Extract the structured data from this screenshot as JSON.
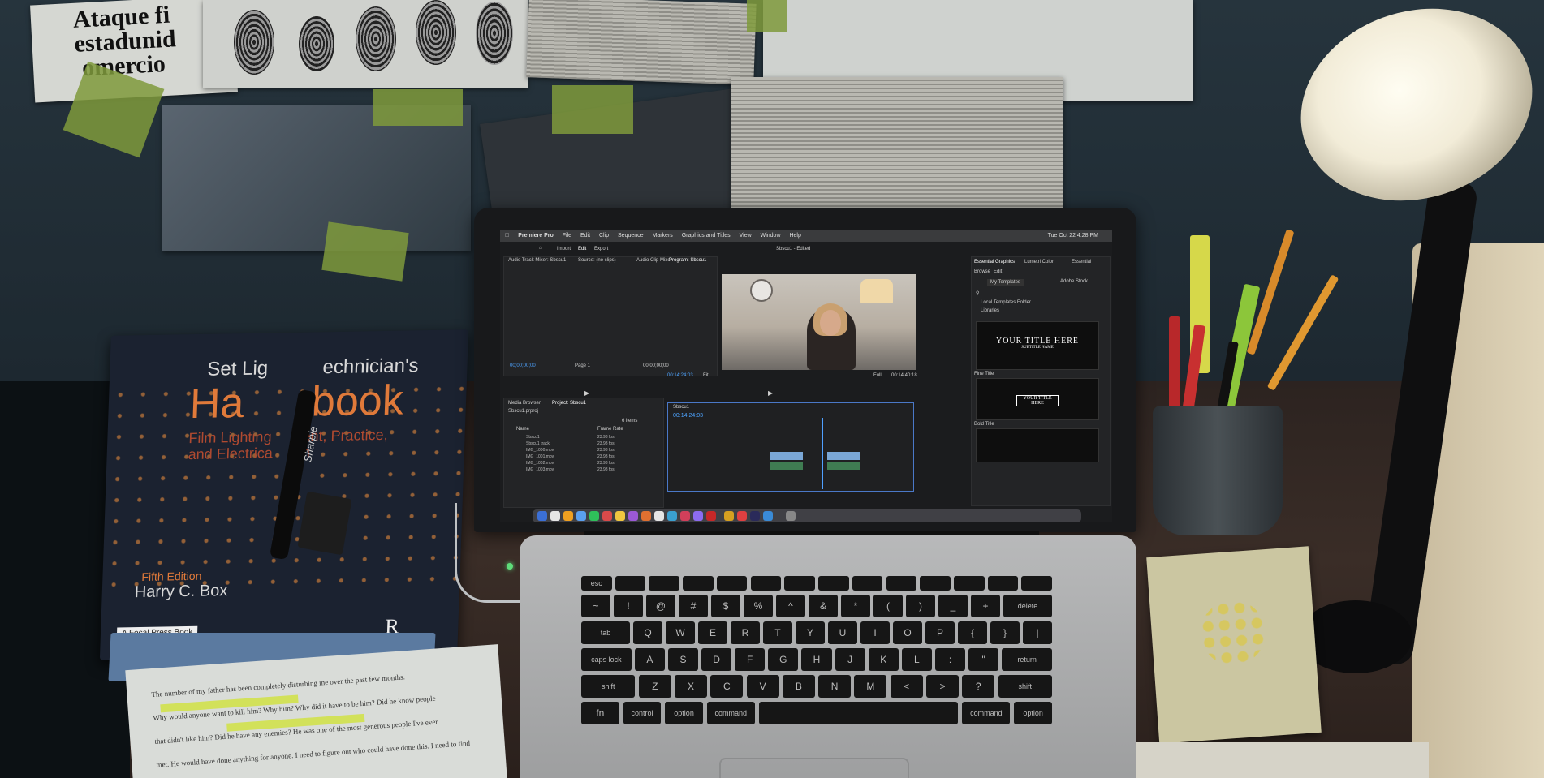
{
  "wall_clippings": {
    "spanish_headline": [
      "Ataque fi",
      "estadunid",
      "omercio"
    ]
  },
  "book": {
    "title_line1": "Set Lig",
    "title_line1b": "echnician's",
    "title_big_left": "Ha",
    "title_big_right": "book",
    "subtitle_lines": [
      "Film Lighting",
      "and Electrica"
    ],
    "subtitle_right": [
      "ent, Practice,",
      "n"
    ],
    "edition": "Fifth Edition",
    "author": "Harry C. Box",
    "publisher": "A Focal Press Book",
    "logo_letter": "R",
    "pen_brand": "Sharpie"
  },
  "document_bottom_left": {
    "lines": [
      "The number of my father has been completely disturbing me over the past few months.",
      "Why would anyone want to kill him? Why him? Why did it have to be him? Did he know people",
      "that didn't like him? Did he have any enemies? He was one of the most generous people I've ever",
      "met. He would have done anything for anyone. I need to figure out who could have done this. I need to find"
    ]
  },
  "laptop_screen": {
    "menubar": {
      "app": "Premiere Pro",
      "items": [
        "File",
        "Edit",
        "Clip",
        "Sequence",
        "Markers",
        "Graphics and Titles",
        "View",
        "Window",
        "Help"
      ],
      "datetime": "Tue Oct 22  4:28 PM"
    },
    "workspace_tabs": [
      "Import",
      "Edit",
      "Export"
    ],
    "window_title": "Sbscu1 - Edited",
    "source_tabs": [
      "Audio Track Mixer: Sbscu1",
      "Source: (no clips)",
      "Audio Clip Mixer"
    ],
    "source_timecodes": [
      "00;00;00;00",
      "00;00;00;00"
    ],
    "source_page": "Page 1",
    "program_tab": "Program: Sbscu1",
    "program_timecode_left": "00:14:24:03",
    "program_fit": "Fit",
    "program_full": "Full",
    "program_timecode_right": "00:14:40:18",
    "project_tabs": [
      "Media Browser",
      "Project: Sbscu1"
    ],
    "project_name": "Sbscu1.prproj",
    "project_items_count": "6 items",
    "project_columns": [
      "Name",
      "Frame Rate"
    ],
    "project_items": [
      {
        "name": "Sbscu1",
        "fps": "23.98 fps"
      },
      {
        "name": "Sbscu1 track",
        "fps": "23.98 fps"
      },
      {
        "name": "IMG_1000.mov",
        "fps": "23.98 fps"
      },
      {
        "name": "IMG_1001.mov",
        "fps": "23.98 fps"
      },
      {
        "name": "IMG_1002.mov",
        "fps": "23.98 fps"
      },
      {
        "name": "IMG_1003.mov",
        "fps": "23.98 fps"
      }
    ],
    "timeline_tab": "Sbscu1",
    "timeline_timecode": "00:14:24:03",
    "essential_graphics": {
      "tabs": [
        "Essential Graphics",
        "Lumetri Color",
        "Essential"
      ],
      "subtabs": [
        "Browse",
        "Edit"
      ],
      "dropdown": "My Templates",
      "adobe_stock": "Adobe Stock",
      "checkboxes": [
        "Local Templates Folder",
        "Libraries"
      ],
      "template1_title": "YOUR TITLE HERE",
      "template1_sub": "SUBTITLE NAME",
      "template2_label": "Fine Title",
      "template2_title": "YOUR TITLE HERE",
      "template3_label": "Bold Title"
    }
  },
  "keyboard": {
    "row1": [
      "esc",
      "",
      "",
      "",
      "",
      "",
      "",
      "",
      "",
      "",
      "",
      "",
      "",
      ""
    ],
    "row2": [
      "~",
      "!",
      "@",
      "#",
      "$",
      "%",
      "^",
      "&",
      "*",
      "(",
      ")",
      "_",
      "+",
      "delete"
    ],
    "row3": [
      "tab",
      "Q",
      "W",
      "E",
      "R",
      "T",
      "Y",
      "U",
      "I",
      "O",
      "P",
      "{",
      "}",
      "|"
    ],
    "row4": [
      "caps lock",
      "A",
      "S",
      "D",
      "F",
      "G",
      "H",
      "J",
      "K",
      "L",
      ":",
      "\"",
      "return"
    ],
    "row5": [
      "shift",
      "Z",
      "X",
      "C",
      "V",
      "B",
      "N",
      "M",
      "<",
      ">",
      "?",
      "shift"
    ],
    "row6": [
      "fn",
      "control",
      "option",
      "command",
      "",
      "command",
      "option"
    ]
  }
}
